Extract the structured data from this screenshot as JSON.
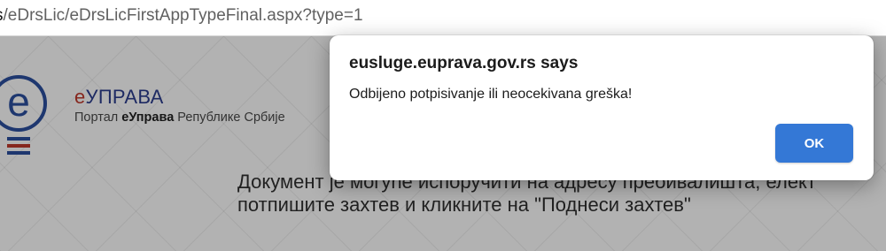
{
  "browser": {
    "url_prefix": "s",
    "url_path": "/eDrsLic/eDrsLicFirstAppTypeFinal.aspx?type=1"
  },
  "page": {
    "brand_name_e": "е",
    "brand_name_rest": "УПРАВА",
    "brand_sub_prefix": "Портал ",
    "brand_sub_bold": "еУправа",
    "brand_sub_suffix": " Републике Србије",
    "doc_line1": "Документ је могуће испоручити на адресу пребивалишта, елект",
    "doc_line2": "потпишите захтев и кликните на \"Поднеси захтев\""
  },
  "dialog": {
    "title": "eusluge.euprava.gov.rs says",
    "message": "Odbijeno potpisivanje ili neocekivana greška!",
    "ok_label": "OK"
  },
  "colors": {
    "ok_button": "#3478d6",
    "brand_blue": "#2b3d8f",
    "brand_red": "#c0392b"
  }
}
